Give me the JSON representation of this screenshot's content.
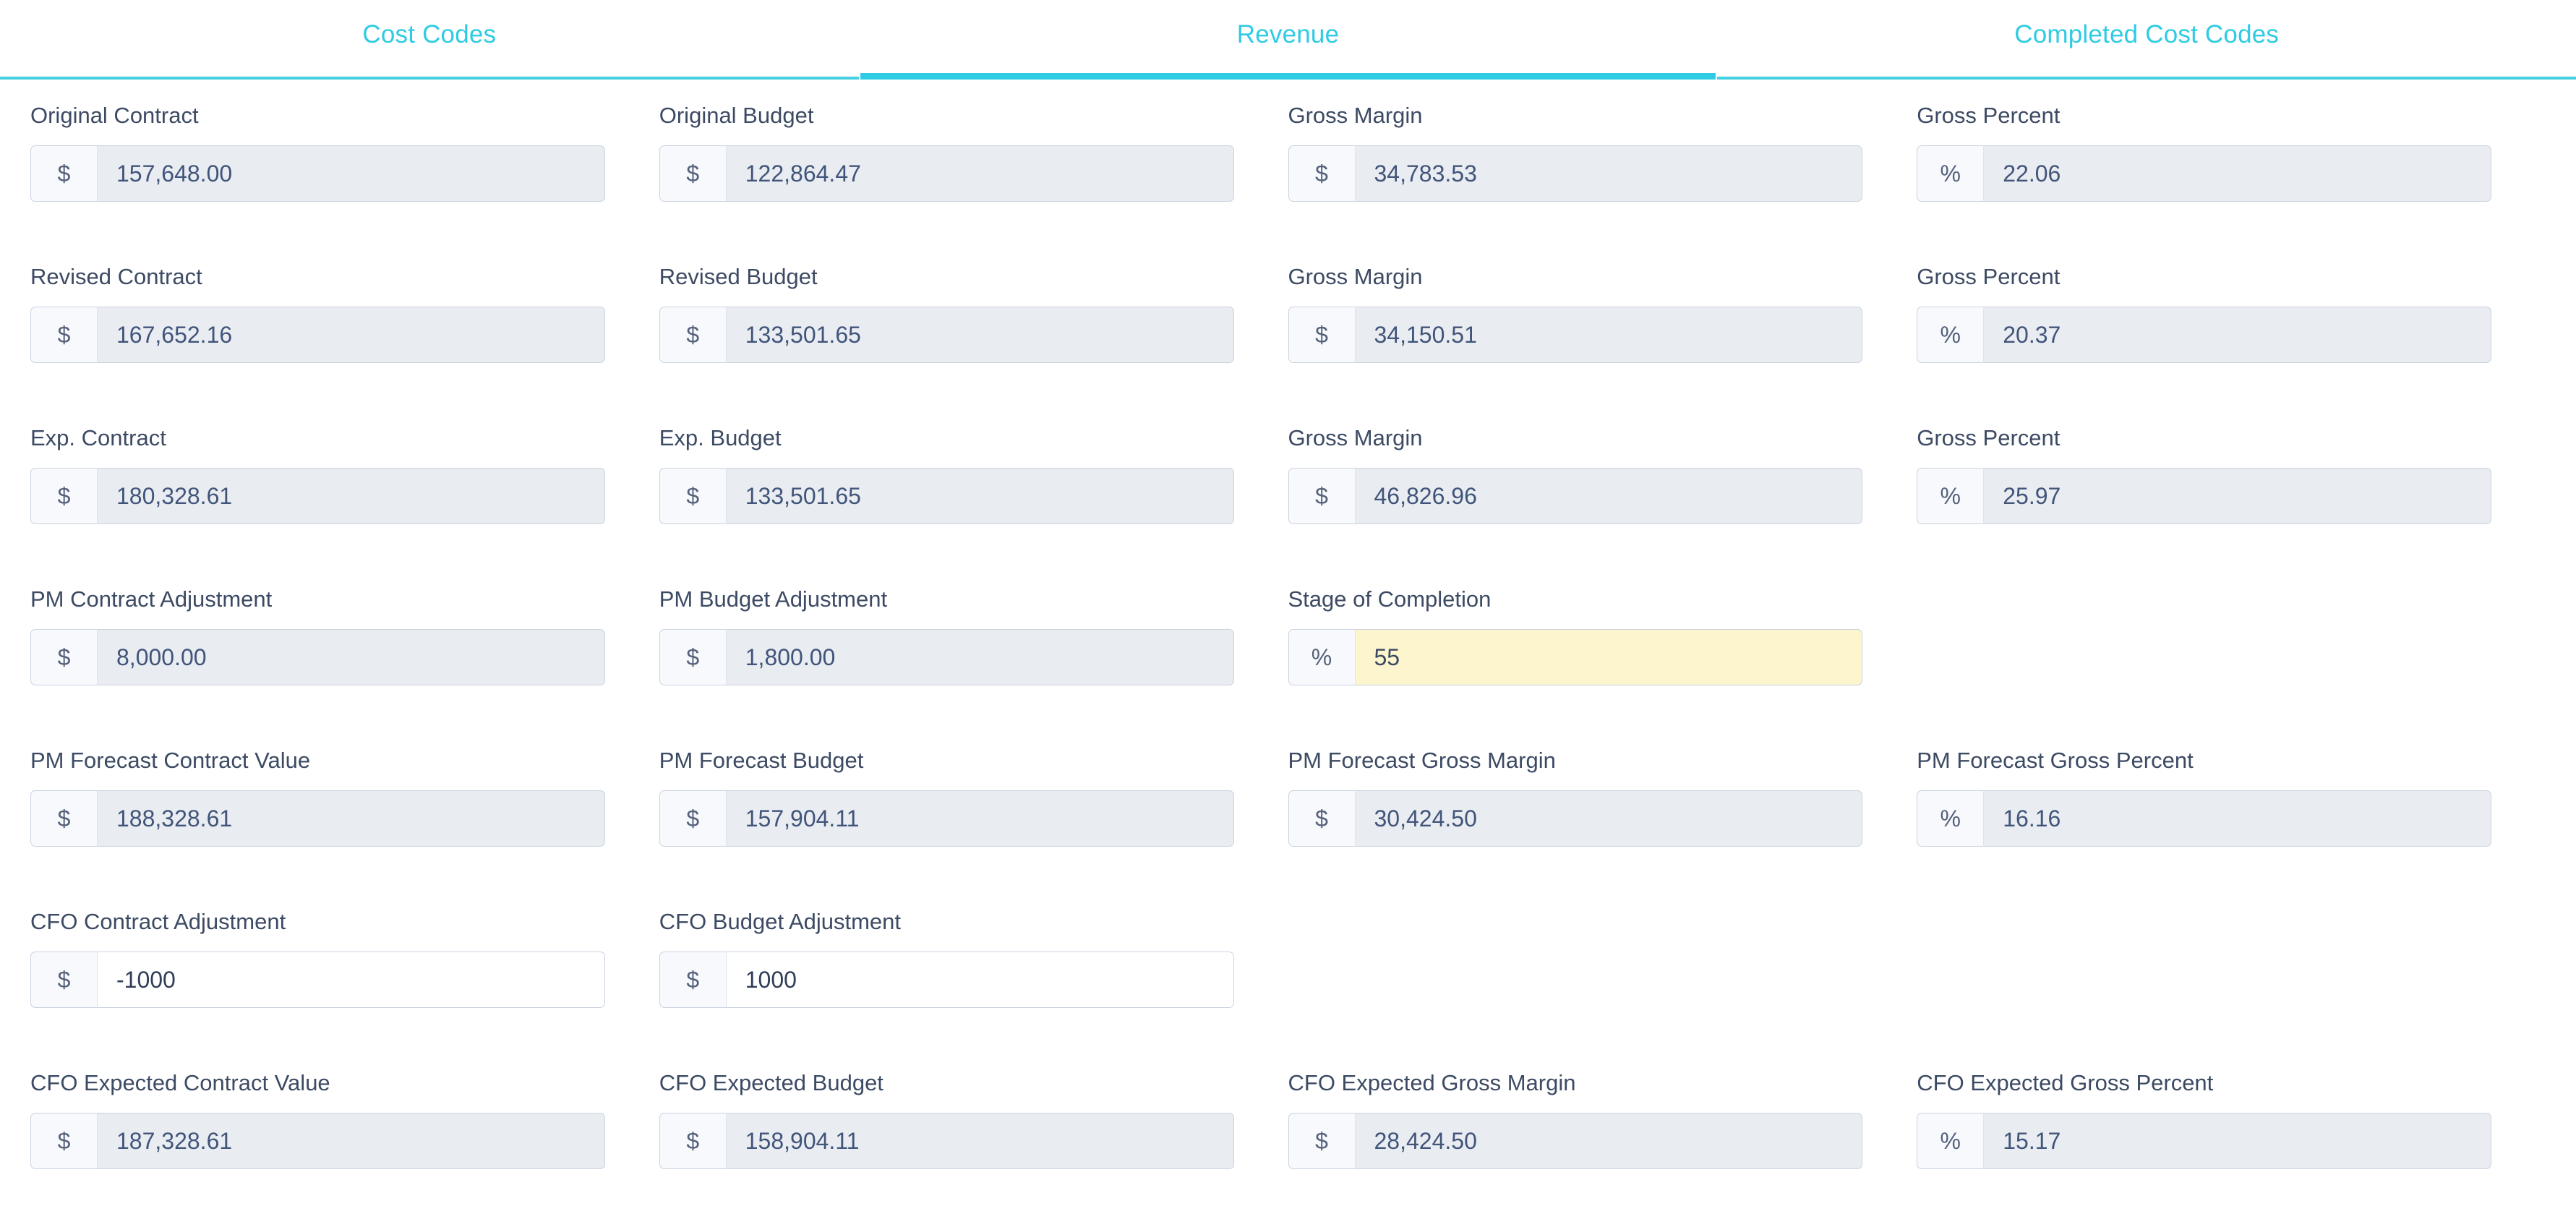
{
  "tabs": [
    {
      "label": "Cost Codes",
      "active": false
    },
    {
      "label": "Revenue",
      "active": true
    },
    {
      "label": "Completed Cost Codes",
      "active": false
    }
  ],
  "colors": {
    "accent": "#2ecbe4",
    "label_text": "#3c4a63",
    "readonly_bg": "#e9edf2",
    "highlight_bg": "#fcf5cd",
    "addon_bg": "#f7f9fc",
    "border": "#cbd3e0"
  },
  "rows": [
    {
      "fields": [
        {
          "label": "Original Contract",
          "prefix": "$",
          "value": "157,648.00",
          "state": "readonly"
        },
        {
          "label": "Original Budget",
          "prefix": "$",
          "value": "122,864.47",
          "state": "readonly"
        },
        {
          "label": "Gross Margin",
          "prefix": "$",
          "value": "34,783.53",
          "state": "readonly"
        },
        {
          "label": "Gross Percent",
          "prefix": "%",
          "value": "22.06",
          "state": "readonly"
        }
      ]
    },
    {
      "fields": [
        {
          "label": "Revised Contract",
          "prefix": "$",
          "value": "167,652.16",
          "state": "readonly"
        },
        {
          "label": "Revised Budget",
          "prefix": "$",
          "value": "133,501.65",
          "state": "readonly"
        },
        {
          "label": "Gross Margin",
          "prefix": "$",
          "value": "34,150.51",
          "state": "readonly"
        },
        {
          "label": "Gross Percent",
          "prefix": "%",
          "value": "20.37",
          "state": "readonly"
        }
      ]
    },
    {
      "fields": [
        {
          "label": "Exp. Contract",
          "prefix": "$",
          "value": "180,328.61",
          "state": "readonly"
        },
        {
          "label": "Exp. Budget",
          "prefix": "$",
          "value": "133,501.65",
          "state": "readonly"
        },
        {
          "label": "Gross Margin",
          "prefix": "$",
          "value": "46,826.96",
          "state": "readonly"
        },
        {
          "label": "Gross Percent",
          "prefix": "%",
          "value": "25.97",
          "state": "readonly"
        }
      ]
    },
    {
      "fields": [
        {
          "label": "PM Contract Adjustment",
          "prefix": "$",
          "value": "8,000.00",
          "state": "readonly"
        },
        {
          "label": "PM Budget Adjustment",
          "prefix": "$",
          "value": "1,800.00",
          "state": "readonly"
        },
        {
          "label": "Stage of Completion",
          "prefix": "%",
          "value": "55",
          "state": "highlight"
        },
        {
          "label": "",
          "prefix": "",
          "value": "",
          "state": "empty"
        }
      ]
    },
    {
      "fields": [
        {
          "label": "PM Forecast Contract Value",
          "prefix": "$",
          "value": "188,328.61",
          "state": "readonly"
        },
        {
          "label": "PM Forecast Budget",
          "prefix": "$",
          "value": "157,904.11",
          "state": "readonly"
        },
        {
          "label": "PM Forecast Gross Margin",
          "prefix": "$",
          "value": "30,424.50",
          "state": "readonly"
        },
        {
          "label": "PM Forecast Gross Percent",
          "prefix": "%",
          "value": "16.16",
          "state": "readonly"
        }
      ]
    },
    {
      "fields": [
        {
          "label": "CFO Contract Adjustment",
          "prefix": "$",
          "value": "-1000",
          "state": "editable"
        },
        {
          "label": "CFO Budget Adjustment",
          "prefix": "$",
          "value": "1000",
          "state": "editable"
        },
        {
          "label": "",
          "prefix": "",
          "value": "",
          "state": "empty"
        },
        {
          "label": "",
          "prefix": "",
          "value": "",
          "state": "empty"
        }
      ]
    },
    {
      "fields": [
        {
          "label": "CFO Expected Contract Value",
          "prefix": "$",
          "value": "187,328.61",
          "state": "readonly"
        },
        {
          "label": "CFO Expected Budget",
          "prefix": "$",
          "value": "158,904.11",
          "state": "readonly"
        },
        {
          "label": "CFO Expected Gross Margin",
          "prefix": "$",
          "value": "28,424.50",
          "state": "readonly"
        },
        {
          "label": "CFO Expected Gross Percent",
          "prefix": "%",
          "value": "15.17",
          "state": "readonly"
        }
      ]
    }
  ]
}
